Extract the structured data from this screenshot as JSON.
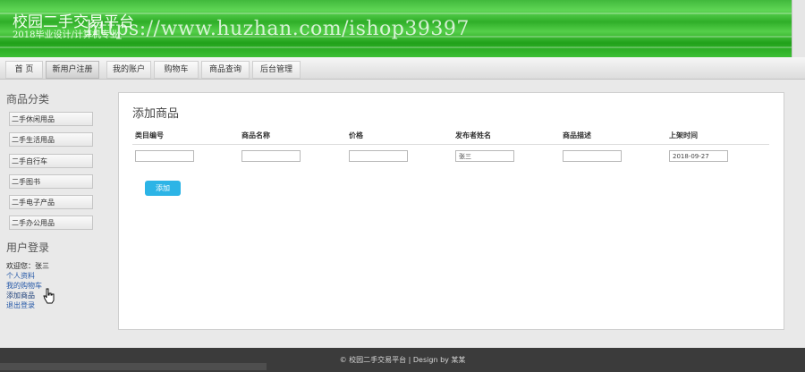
{
  "header": {
    "site_title": "校园二手交易平台",
    "site_subtitle": "2018毕业设计/计算机专业",
    "watermark": "https://www.huzhan.com/ishop39397"
  },
  "nav": {
    "items": [
      {
        "label": "首 页"
      },
      {
        "label": "新用户注册"
      },
      {
        "label": "我的账户"
      },
      {
        "label": "购物车"
      },
      {
        "label": "商品查询"
      },
      {
        "label": "后台管理"
      }
    ]
  },
  "sidebar": {
    "categories_heading": "商品分类",
    "categories": [
      {
        "label": "二手休闲用品"
      },
      {
        "label": "二手生活用品"
      },
      {
        "label": "二手自行车"
      },
      {
        "label": "二手图书"
      },
      {
        "label": "二手电子产品"
      },
      {
        "label": "二手办公用品"
      }
    ],
    "login_heading": "用户登录",
    "welcome": "欢迎您：张三",
    "links": [
      {
        "label": "个人资料"
      },
      {
        "label": "我的购物车"
      },
      {
        "label": "添加商品"
      },
      {
        "label": "退出登录"
      }
    ]
  },
  "main": {
    "title": "添加商品",
    "columns": [
      "类目编号",
      "商品名称",
      "价格",
      "发布者姓名",
      "商品描述",
      "上架时间"
    ],
    "fields": [
      {
        "value": ""
      },
      {
        "value": ""
      },
      {
        "value": ""
      },
      {
        "value": "张三"
      },
      {
        "value": ""
      },
      {
        "value": "2018-09-27"
      }
    ],
    "submit_label": "添加"
  },
  "footer": {
    "text": "© 校园二手交易平台 | Design by 某某"
  },
  "colors": {
    "header_green": "#2fae28",
    "button_blue": "#2cb4e6",
    "link_blue": "#2659a8",
    "footer_bg": "#3b3b3b"
  }
}
